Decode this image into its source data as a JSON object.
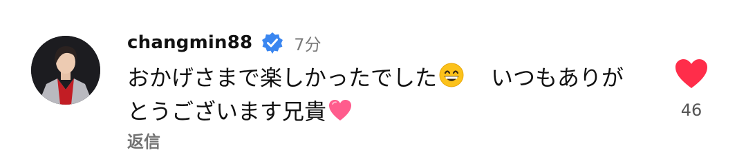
{
  "comment": {
    "username": "changmin88",
    "verified": true,
    "time": "7分",
    "text_line1_a": "おかげさまで楽しかったでした",
    "text_line1_b": "いつもありが",
    "text_line2": "とうございます兄貴",
    "emoji_1": "grinning-face-with-smiling-eyes",
    "emoji_2": "pink-heart",
    "reply_label": "返信",
    "like_count": "46",
    "liked": true
  },
  "colors": {
    "verified_badge": "#3a86f0",
    "liked_heart": "#ff2d4a",
    "pink_heart": "#ff5c8d",
    "secondary_text": "#737373"
  }
}
